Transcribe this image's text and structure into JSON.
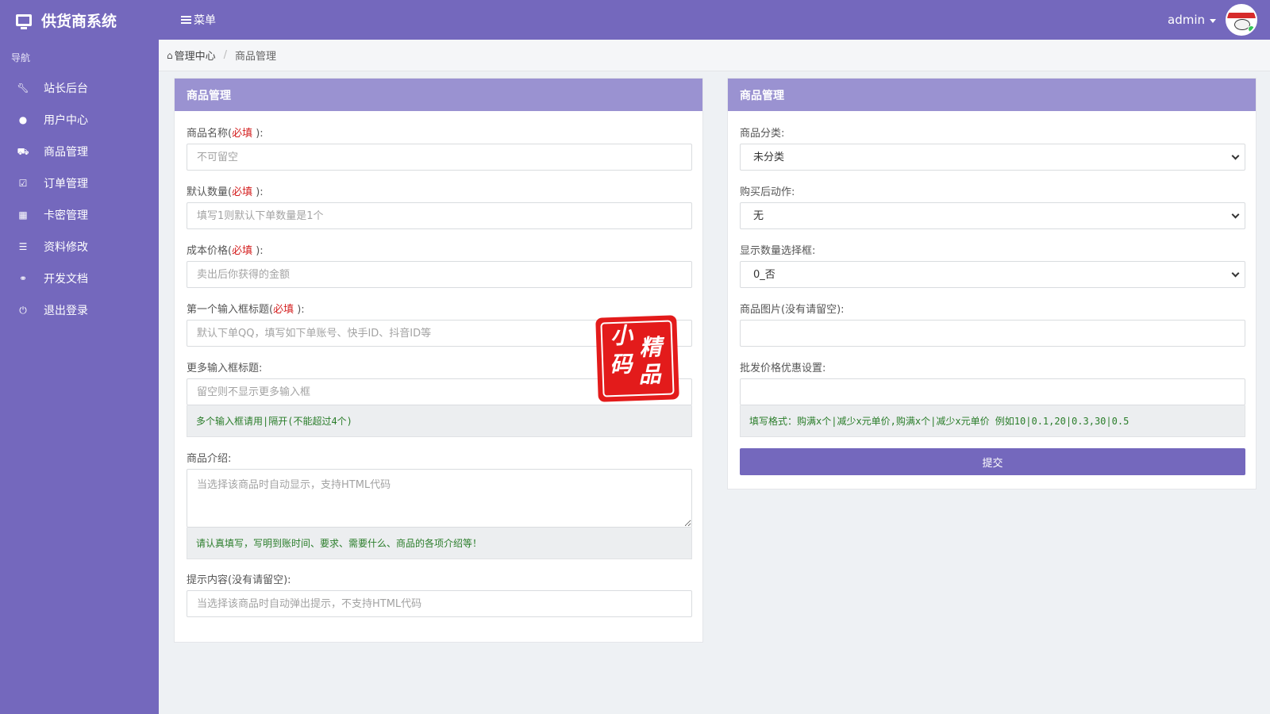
{
  "app": {
    "title": "供货商系统",
    "menu_label": "菜单",
    "user_name": "admin"
  },
  "sidebar": {
    "heading": "导航",
    "items": [
      {
        "label": "站长后台",
        "icon": "wrench-icon"
      },
      {
        "label": "用户中心",
        "icon": "user-icon"
      },
      {
        "label": "商品管理",
        "icon": "cart-icon"
      },
      {
        "label": "订单管理",
        "icon": "check-square-icon"
      },
      {
        "label": "卡密管理",
        "icon": "grid-icon"
      },
      {
        "label": "资料修改",
        "icon": "list-icon"
      },
      {
        "label": "开发文档",
        "icon": "handshake-icon"
      },
      {
        "label": "退出登录",
        "icon": "power-icon"
      }
    ]
  },
  "breadcrumb": {
    "home": "管理中心",
    "current": "商品管理"
  },
  "left_panel": {
    "title": "商品管理",
    "required_mark": "必填",
    "name": {
      "label": "商品名称(",
      "label_end": " ):",
      "placeholder": "不可留空"
    },
    "quantity": {
      "label": "默认数量(",
      "label_end": " ):",
      "placeholder": "填写1则默认下单数量是1个"
    },
    "cost": {
      "label": "成本价格(",
      "label_end": " ):",
      "placeholder": "卖出后你获得的金额"
    },
    "first_input": {
      "label": "第一个输入框标题(",
      "label_end": " ):",
      "placeholder": "默认下单QQ，填写如下单账号、快手ID、抖音ID等"
    },
    "more_inputs": {
      "label": "更多输入框标题:",
      "placeholder": "留空则不显示更多输入框",
      "help": "多个输入框请用|隔开(不能超过4个)"
    },
    "intro": {
      "label": "商品介绍:",
      "placeholder": "当选择该商品时自动显示，支持HTML代码",
      "help": "请认真填写，写明到账时间、要求、需要什么、商品的各项介绍等！"
    },
    "tip": {
      "label": "提示内容(没有请留空):",
      "placeholder": "当选择该商品时自动弹出提示，不支持HTML代码"
    }
  },
  "right_panel": {
    "title": "商品管理",
    "category": {
      "label": "商品分类:",
      "value": "未分类"
    },
    "after_buy": {
      "label": "购买后动作:",
      "value": "无"
    },
    "qty_select": {
      "label": "显示数量选择框:",
      "value": "0_否"
    },
    "image": {
      "label": "商品图片(没有请留空):",
      "value": ""
    },
    "wholesale": {
      "label": "批发价格优惠设置:",
      "value": "",
      "help": "填写格式：购满x个|减少x元单价,购满x个|减少x元单价  例如10|0.1,20|0.3,30|0.5"
    },
    "submit_label": "提交"
  },
  "watermark": {
    "chars": [
      "小",
      "精",
      "码",
      "品"
    ]
  }
}
